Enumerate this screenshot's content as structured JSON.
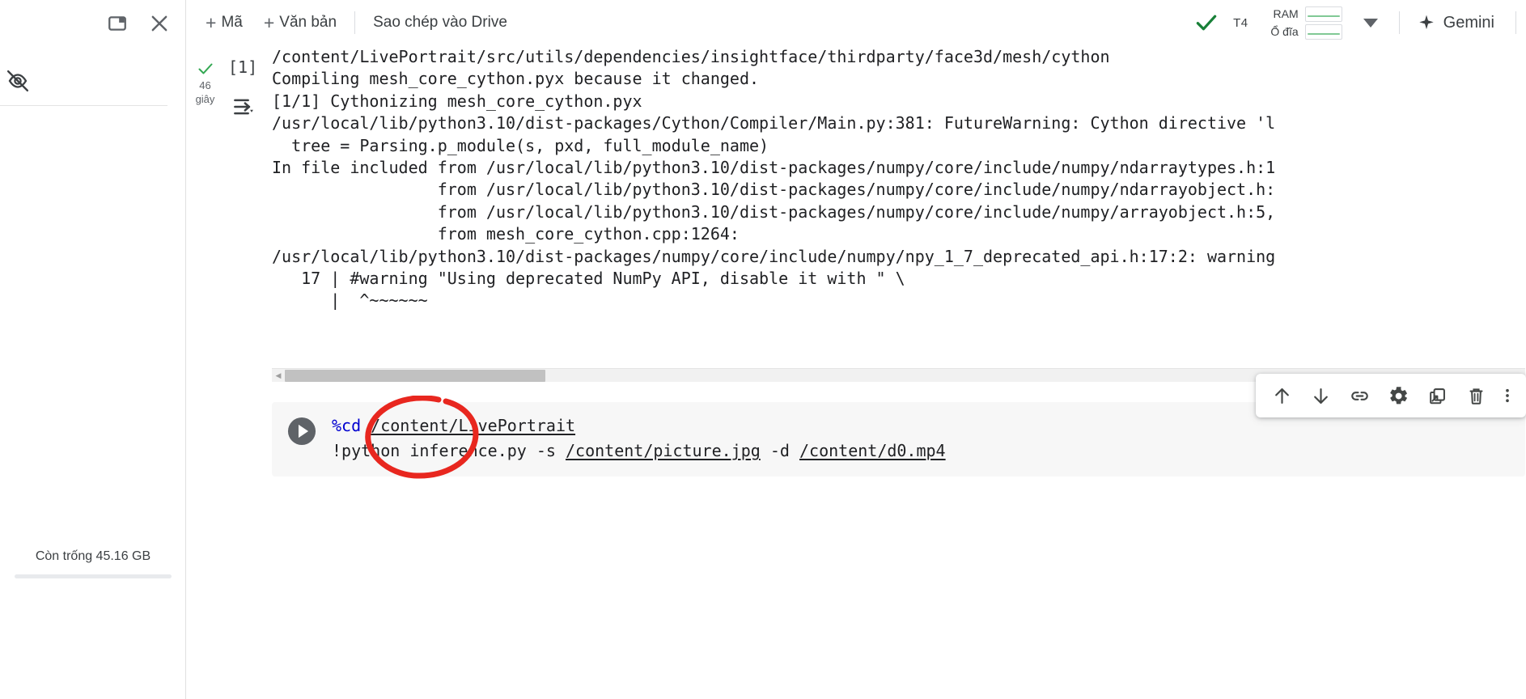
{
  "sidebar": {
    "panel_toggle_icon": "panel-layout-icon",
    "close_icon": "close-icon",
    "visibility_off_icon": "eye-off-icon",
    "storage_text": "Còn trống 45.16 GB"
  },
  "toolbar": {
    "add_code_label": "Mã",
    "add_text_label": "Văn bản",
    "plus_glyph": "+",
    "copy_to_drive_label": "Sao chép vào Drive",
    "connected_check_icon": "check-icon",
    "gpu_label": "T4",
    "resources": [
      {
        "label": "RAM",
        "sparkline_color": "#81c995"
      },
      {
        "label": "Ổ đĩa",
        "sparkline_color": "#81c995"
      }
    ],
    "dropdown_icon": "caret-down-icon",
    "gemini_label": "Gemini",
    "gemini_icon": "sparkle-icon"
  },
  "output_cell": {
    "status_icon": "check-icon",
    "elapsed_value": "46",
    "elapsed_unit": "giây",
    "execution_count": "[1]",
    "stream_icon": "output-stream-icon",
    "lines": [
      "/content/LivePortrait/src/utils/dependencies/insightface/thirdparty/face3d/mesh/cython",
      "Compiling mesh_core_cython.pyx because it changed.",
      "[1/1] Cythonizing mesh_core_cython.pyx",
      "/usr/local/lib/python3.10/dist-packages/Cython/Compiler/Main.py:381: FutureWarning: Cython directive 'l",
      "  tree = Parsing.p_module(s, pxd, full_module_name)",
      "In file included from /usr/local/lib/python3.10/dist-packages/numpy/core/include/numpy/ndarraytypes.h:1",
      "                 from /usr/local/lib/python3.10/dist-packages/numpy/core/include/numpy/ndarrayobject.h:",
      "                 from /usr/local/lib/python3.10/dist-packages/numpy/core/include/numpy/arrayobject.h:5,",
      "                 from mesh_core_cython.cpp:1264:",
      "/usr/local/lib/python3.10/dist-packages/numpy/core/include/numpy/npy_1_7_deprecated_api.h:17:2: warning",
      "   17 | #warning \"Using deprecated NumPy API, disable it with \" \\",
      "      |  ^~~~~~~"
    ],
    "scrollbar": {
      "left_arrow_icon": "scroll-left-arrow-icon",
      "thumb_width_px": "322"
    }
  },
  "cell_toolbar": {
    "buttons": [
      {
        "name": "move-cell-up-button",
        "icon": "arrow-up-icon"
      },
      {
        "name": "move-cell-down-button",
        "icon": "arrow-down-icon"
      },
      {
        "name": "copy-cell-link-button",
        "icon": "link-icon"
      },
      {
        "name": "cell-settings-button",
        "icon": "gear-icon"
      },
      {
        "name": "open-in-new-tab-button",
        "icon": "open-in-new-icon"
      },
      {
        "name": "delete-cell-button",
        "icon": "trash-icon"
      },
      {
        "name": "more-options-button",
        "icon": "more-vertical-icon"
      }
    ]
  },
  "code_cell": {
    "run_icon": "play-icon",
    "line1": {
      "magic": "%cd",
      "space": " ",
      "path": "/content/LivePortrait"
    },
    "line2": {
      "prefix": "!python inference.py -s ",
      "path1": "/content/picture.jpg",
      "mid": " -d ",
      "path2": "/content/d0.mp4"
    }
  },
  "annotation": {
    "ellipse_color": "#e8271f",
    "name": "red-ellipse-highlight"
  }
}
